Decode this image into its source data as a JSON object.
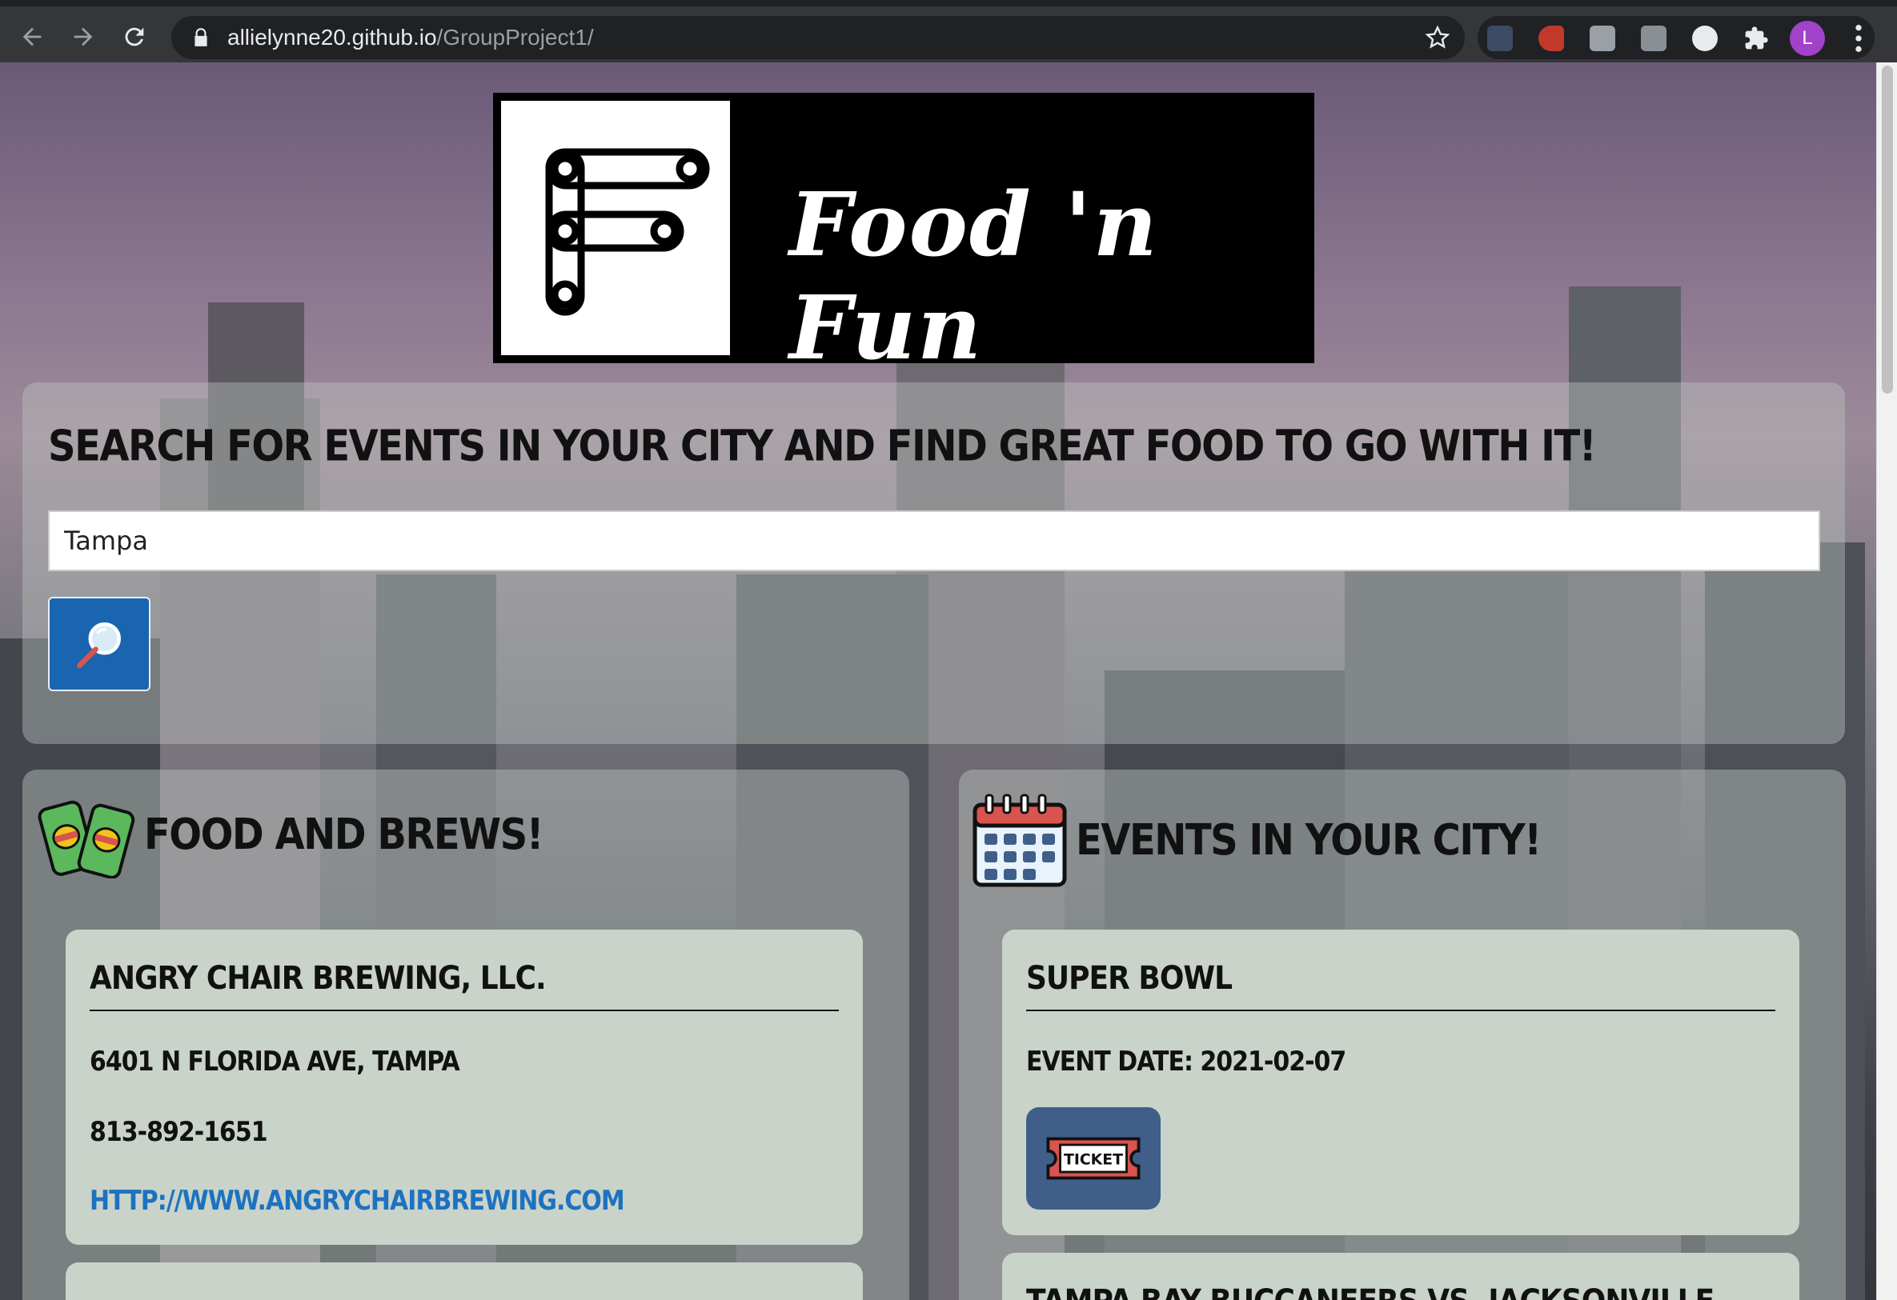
{
  "browser": {
    "url_host": "allielynne20.github.io",
    "url_path": "/GroupProject1/",
    "avatar_letter": "L"
  },
  "banner": {
    "title": "Food 'n Fun",
    "logo_letter": "F"
  },
  "search": {
    "heading": "SEARCH FOR EVENTS IN YOUR CITY AND FIND GREAT FOOD TO GO WITH IT!",
    "value": "Tampa"
  },
  "food": {
    "title": "FOOD AND BREWS!",
    "cards": [
      {
        "name": "ANGRY CHAIR BREWING, LLC.",
        "address": "6401 N FLORIDA AVE, TAMPA",
        "phone": "813-892-1651",
        "website": "HTTP://WWW.ANGRYCHAIRBREWING.COM"
      }
    ]
  },
  "events": {
    "title": "EVENTS IN YOUR CITY!",
    "cards": [
      {
        "name": "SUPER BOWL",
        "date": "EVENT DATE: 2021-02-07",
        "ticket_label": "TICKET"
      },
      {
        "name": "TAMPA BAY BUCCANEERS VS. JACKSONVILLE JAGUARS"
      }
    ]
  },
  "colors": {
    "search_button": "#1a65b0",
    "link": "#1d72c0",
    "card_bg": "#c9d3c9"
  }
}
